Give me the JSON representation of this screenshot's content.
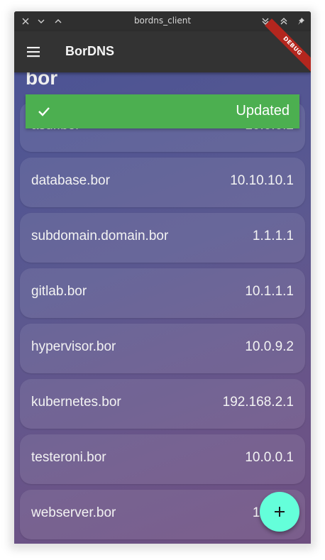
{
  "window": {
    "title": "bordns_client",
    "controls": [
      "close-icon",
      "minimize-icon",
      "maximize-icon",
      "shade-down-icon",
      "shade-up-icon",
      "pin-icon"
    ]
  },
  "appbar": {
    "menu_icon": "hamburger-menu-icon",
    "title": "BorDNS",
    "debug_banner": "DEBUG",
    "banner_color": "#b3261e"
  },
  "main": {
    "heading": "bor",
    "records": [
      {
        "name": "asdf.bor",
        "ip": "10.0.0.2"
      },
      {
        "name": "database.bor",
        "ip": "10.10.10.1"
      },
      {
        "name": "subdomain.domain.bor",
        "ip": "1.1.1.1"
      },
      {
        "name": "gitlab.bor",
        "ip": "10.1.1.1"
      },
      {
        "name": "hypervisor.bor",
        "ip": "10.0.9.2"
      },
      {
        "name": "kubernetes.bor",
        "ip": "192.168.2.1"
      },
      {
        "name": "testeroni.bor",
        "ip": "10.0.0.1"
      },
      {
        "name": "webserver.bor",
        "ip": "192.16"
      }
    ]
  },
  "snackbar": {
    "icon": "check-icon",
    "text": "Updated",
    "color": "#4caf50"
  },
  "fab": {
    "icon": "plus-icon",
    "color": "#64ffda"
  }
}
